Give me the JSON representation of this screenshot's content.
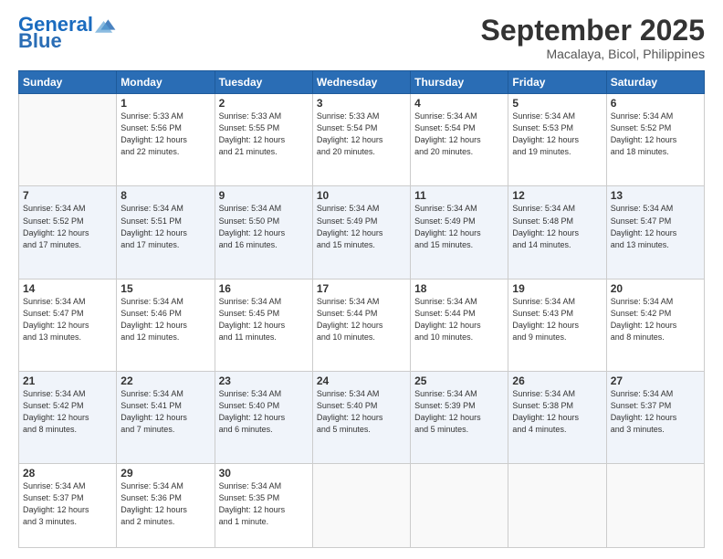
{
  "header": {
    "logo_general": "General",
    "logo_blue": "Blue",
    "month_title": "September 2025",
    "location": "Macalaya, Bicol, Philippines"
  },
  "days_of_week": [
    "Sunday",
    "Monday",
    "Tuesday",
    "Wednesday",
    "Thursday",
    "Friday",
    "Saturday"
  ],
  "weeks": [
    [
      {
        "day": "",
        "info": ""
      },
      {
        "day": "1",
        "info": "Sunrise: 5:33 AM\nSunset: 5:56 PM\nDaylight: 12 hours\nand 22 minutes."
      },
      {
        "day": "2",
        "info": "Sunrise: 5:33 AM\nSunset: 5:55 PM\nDaylight: 12 hours\nand 21 minutes."
      },
      {
        "day": "3",
        "info": "Sunrise: 5:33 AM\nSunset: 5:54 PM\nDaylight: 12 hours\nand 20 minutes."
      },
      {
        "day": "4",
        "info": "Sunrise: 5:34 AM\nSunset: 5:54 PM\nDaylight: 12 hours\nand 20 minutes."
      },
      {
        "day": "5",
        "info": "Sunrise: 5:34 AM\nSunset: 5:53 PM\nDaylight: 12 hours\nand 19 minutes."
      },
      {
        "day": "6",
        "info": "Sunrise: 5:34 AM\nSunset: 5:52 PM\nDaylight: 12 hours\nand 18 minutes."
      }
    ],
    [
      {
        "day": "7",
        "info": "Sunrise: 5:34 AM\nSunset: 5:52 PM\nDaylight: 12 hours\nand 17 minutes."
      },
      {
        "day": "8",
        "info": "Sunrise: 5:34 AM\nSunset: 5:51 PM\nDaylight: 12 hours\nand 17 minutes."
      },
      {
        "day": "9",
        "info": "Sunrise: 5:34 AM\nSunset: 5:50 PM\nDaylight: 12 hours\nand 16 minutes."
      },
      {
        "day": "10",
        "info": "Sunrise: 5:34 AM\nSunset: 5:49 PM\nDaylight: 12 hours\nand 15 minutes."
      },
      {
        "day": "11",
        "info": "Sunrise: 5:34 AM\nSunset: 5:49 PM\nDaylight: 12 hours\nand 15 minutes."
      },
      {
        "day": "12",
        "info": "Sunrise: 5:34 AM\nSunset: 5:48 PM\nDaylight: 12 hours\nand 14 minutes."
      },
      {
        "day": "13",
        "info": "Sunrise: 5:34 AM\nSunset: 5:47 PM\nDaylight: 12 hours\nand 13 minutes."
      }
    ],
    [
      {
        "day": "14",
        "info": "Sunrise: 5:34 AM\nSunset: 5:47 PM\nDaylight: 12 hours\nand 13 minutes."
      },
      {
        "day": "15",
        "info": "Sunrise: 5:34 AM\nSunset: 5:46 PM\nDaylight: 12 hours\nand 12 minutes."
      },
      {
        "day": "16",
        "info": "Sunrise: 5:34 AM\nSunset: 5:45 PM\nDaylight: 12 hours\nand 11 minutes."
      },
      {
        "day": "17",
        "info": "Sunrise: 5:34 AM\nSunset: 5:44 PM\nDaylight: 12 hours\nand 10 minutes."
      },
      {
        "day": "18",
        "info": "Sunrise: 5:34 AM\nSunset: 5:44 PM\nDaylight: 12 hours\nand 10 minutes."
      },
      {
        "day": "19",
        "info": "Sunrise: 5:34 AM\nSunset: 5:43 PM\nDaylight: 12 hours\nand 9 minutes."
      },
      {
        "day": "20",
        "info": "Sunrise: 5:34 AM\nSunset: 5:42 PM\nDaylight: 12 hours\nand 8 minutes."
      }
    ],
    [
      {
        "day": "21",
        "info": "Sunrise: 5:34 AM\nSunset: 5:42 PM\nDaylight: 12 hours\nand 8 minutes."
      },
      {
        "day": "22",
        "info": "Sunrise: 5:34 AM\nSunset: 5:41 PM\nDaylight: 12 hours\nand 7 minutes."
      },
      {
        "day": "23",
        "info": "Sunrise: 5:34 AM\nSunset: 5:40 PM\nDaylight: 12 hours\nand 6 minutes."
      },
      {
        "day": "24",
        "info": "Sunrise: 5:34 AM\nSunset: 5:40 PM\nDaylight: 12 hours\nand 5 minutes."
      },
      {
        "day": "25",
        "info": "Sunrise: 5:34 AM\nSunset: 5:39 PM\nDaylight: 12 hours\nand 5 minutes."
      },
      {
        "day": "26",
        "info": "Sunrise: 5:34 AM\nSunset: 5:38 PM\nDaylight: 12 hours\nand 4 minutes."
      },
      {
        "day": "27",
        "info": "Sunrise: 5:34 AM\nSunset: 5:37 PM\nDaylight: 12 hours\nand 3 minutes."
      }
    ],
    [
      {
        "day": "28",
        "info": "Sunrise: 5:34 AM\nSunset: 5:37 PM\nDaylight: 12 hours\nand 3 minutes."
      },
      {
        "day": "29",
        "info": "Sunrise: 5:34 AM\nSunset: 5:36 PM\nDaylight: 12 hours\nand 2 minutes."
      },
      {
        "day": "30",
        "info": "Sunrise: 5:34 AM\nSunset: 5:35 PM\nDaylight: 12 hours\nand 1 minute."
      },
      {
        "day": "",
        "info": ""
      },
      {
        "day": "",
        "info": ""
      },
      {
        "day": "",
        "info": ""
      },
      {
        "day": "",
        "info": ""
      }
    ]
  ]
}
